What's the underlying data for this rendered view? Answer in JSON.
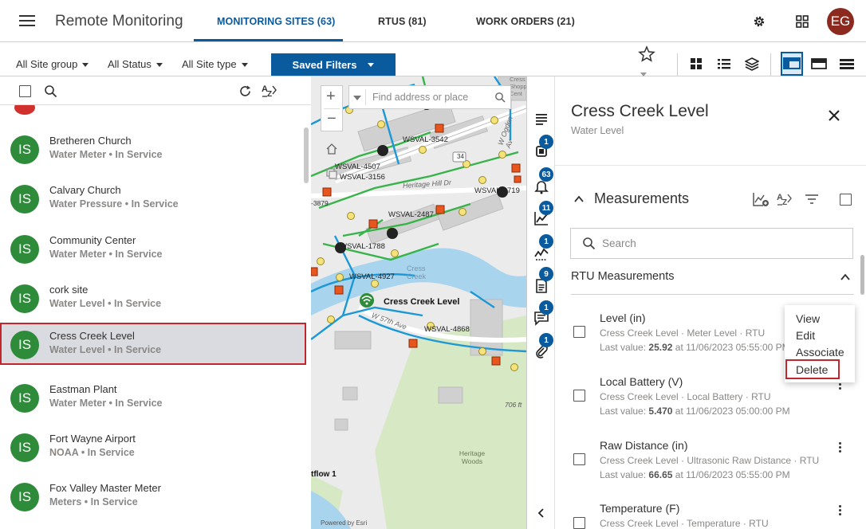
{
  "header": {
    "app_title": "Remote Monitoring",
    "tabs": [
      {
        "label": "MONITORING SITES (63)"
      },
      {
        "label": "RTUS (81)"
      },
      {
        "label": "WORK ORDERS (21)"
      }
    ],
    "user_initials": "EG"
  },
  "filters": {
    "site_group": "All Site group",
    "status": "All Status",
    "site_type": "All Site type",
    "saved_filters": "Saved Filters"
  },
  "sites": [
    {
      "initials": "IS",
      "name": "Bretheren Church",
      "meta": "Water Meter • In Service"
    },
    {
      "initials": "IS",
      "name": "Calvary Church",
      "meta": "Water Pressure • In Service"
    },
    {
      "initials": "IS",
      "name": "Community Center",
      "meta": "Water Meter • In Service"
    },
    {
      "initials": "IS",
      "name": "cork site",
      "meta": "Water Level • In Service"
    },
    {
      "initials": "IS",
      "name": "Cress Creek Level",
      "meta": "Water Level • In Service"
    },
    {
      "initials": "IS",
      "name": "Eastman Plant",
      "meta": "Water Meter • In Service"
    },
    {
      "initials": "IS",
      "name": "Fort Wayne Airport",
      "meta": "NOAA • In Service"
    },
    {
      "initials": "IS",
      "name": "Fox Valley Master Meter",
      "meta": "Meters • In Service"
    }
  ],
  "map": {
    "search_placeholder": "Find address or place",
    "labels": {
      "cress_creek_site": "Cress Creek Level",
      "cress_creek_water": "Cress Creek",
      "wsval_3542": "WSVAL-3542",
      "wsval_4507": "WSVAL-4507",
      "wsval_3156": "WSVAL-3156",
      "wsval_2719": "WSVAL-2719",
      "wsval_2487": "WSVAL-2487",
      "wsval_1788": "WSVAL-1788",
      "wsval_4927": "WSVAL-4927",
      "wsval_4868": "WSVAL-4868",
      "heritage_hill": "Heritage Hill Dr",
      "w_ogden": "W Ogden Av",
      "w_57th": "W 57th Ave",
      "heritage_woods": "Heritage Woods",
      "route_34": "34",
      "flow": "tflow 1",
      "n3879": "-3879",
      "n706": "706 ft",
      "cress_shopping": "Cress Shopp Cent",
      "esri": "Powered by Esri"
    }
  },
  "rail_badges": {
    "rtu": "1",
    "alarms": "63",
    "trends": "11",
    "flow": "1",
    "notes": "9",
    "chat": "1",
    "attach": "1"
  },
  "detail": {
    "title": "Cress Creek Level",
    "subtitle": "Water Level",
    "section_title": "Measurements",
    "search_placeholder": "Search",
    "group_title": "RTU Measurements",
    "last_value_label": "Last value:",
    "measurements": [
      {
        "name": "Level (in)",
        "meta": "Cress Creek Level · Meter Level · RTU",
        "value": "25.92",
        "time": "at 11/06/2023 05:55:00 PM"
      },
      {
        "name": "Local Battery (V)",
        "meta": "Cress Creek Level · Local Battery · RTU",
        "value": "5.470",
        "time": "at 11/06/2023 05:00:00 PM"
      },
      {
        "name": "Raw Distance (in)",
        "meta": "Cress Creek Level · Ultrasonic Raw Distance · RTU",
        "value": "66.65",
        "time": "at 11/06/2023 05:55:00 PM"
      },
      {
        "name": "Temperature (F)",
        "meta": "Cress Creek Level · Temperature · RTU"
      }
    ]
  },
  "context_menu": {
    "view": "View",
    "edit": "Edit",
    "associate": "Associate",
    "delete": "Delete"
  },
  "colors": {
    "accent": "#0a5a9e",
    "site_avatar": "#2e8b3a",
    "user_avatar": "#8c2a1f",
    "highlight": "#c0272d"
  }
}
